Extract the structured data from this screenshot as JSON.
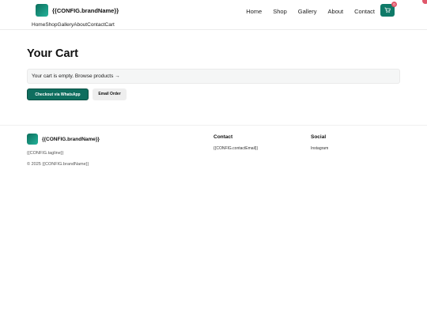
{
  "header": {
    "brand_name": "{{CONFIG.brandName}}",
    "nav": [
      "Home",
      "Shop",
      "Gallery",
      "About",
      "Contact"
    ],
    "cart_count": "0",
    "cart_icon": "shopping-cart-icon"
  },
  "plain_nav": [
    "Home",
    "Shop",
    "Gallery",
    "About",
    "Contact",
    "Cart"
  ],
  "main": {
    "title": "Your Cart",
    "empty_message": "Your cart is empty. Browse products →",
    "whatsapp_button": "Checkout via WhatsApp",
    "email_button": "Email Order"
  },
  "footer": {
    "brand_name": "{{CONFIG.brandName}}",
    "tagline": "{{CONFIG.tagline}}",
    "copyright": "© 2025 {{CONFIG.brandName}}",
    "contact_heading": "Contact",
    "contact_email": "{{CONFIG.contactEmail}}",
    "social_heading": "Social",
    "social_link": "Instagram"
  },
  "colors": {
    "accent": "#0f7a68",
    "badge": "#e0576a"
  }
}
